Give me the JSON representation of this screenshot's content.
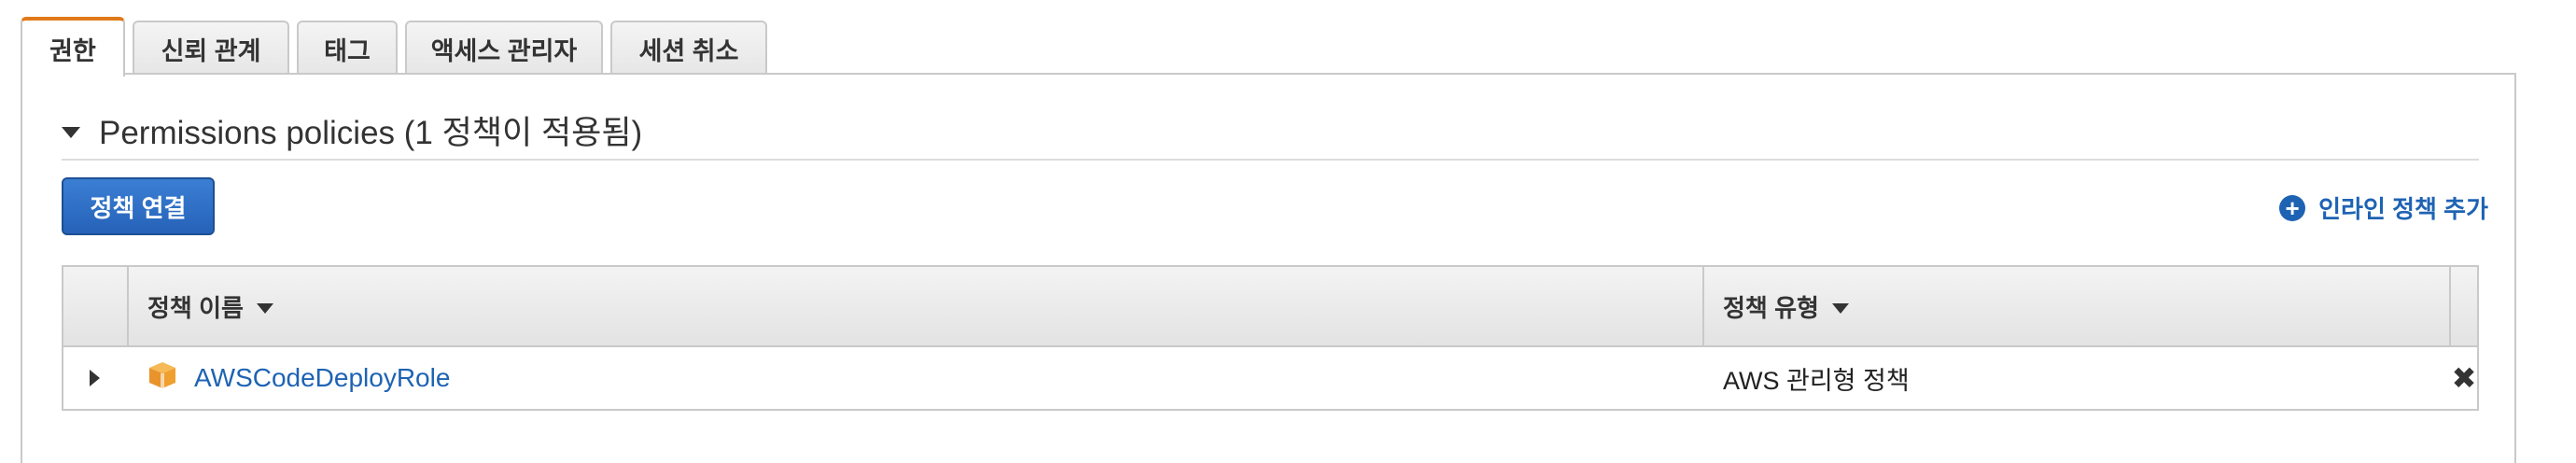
{
  "tabs": [
    {
      "label": "권한",
      "active": true
    },
    {
      "label": "신뢰 관계",
      "active": false
    },
    {
      "label": "태그",
      "active": false
    },
    {
      "label": "액세스 관리자",
      "active": false
    },
    {
      "label": "세션 취소",
      "active": false
    }
  ],
  "section": {
    "title": "Permissions policies (1 정책이 적용됨)"
  },
  "actions": {
    "attach_label": "정책 연결",
    "inline_add_label": "인라인 정책 추가"
  },
  "table": {
    "columns": [
      "정책 이름",
      "정책 유형"
    ],
    "rows": [
      {
        "name": "AWSCodeDeployRole",
        "type": "AWS 관리형 정책"
      }
    ]
  },
  "colors": {
    "accent_tab": "#e0791a",
    "primary_button": "#2562b8",
    "link": "#1e63b3",
    "policy_icon": "#f0a030"
  },
  "icons": {
    "expand": "caret-right-icon",
    "policy": "aws-managed-policy-box-icon",
    "remove": "close-x-icon",
    "add": "plus-circle-icon"
  }
}
